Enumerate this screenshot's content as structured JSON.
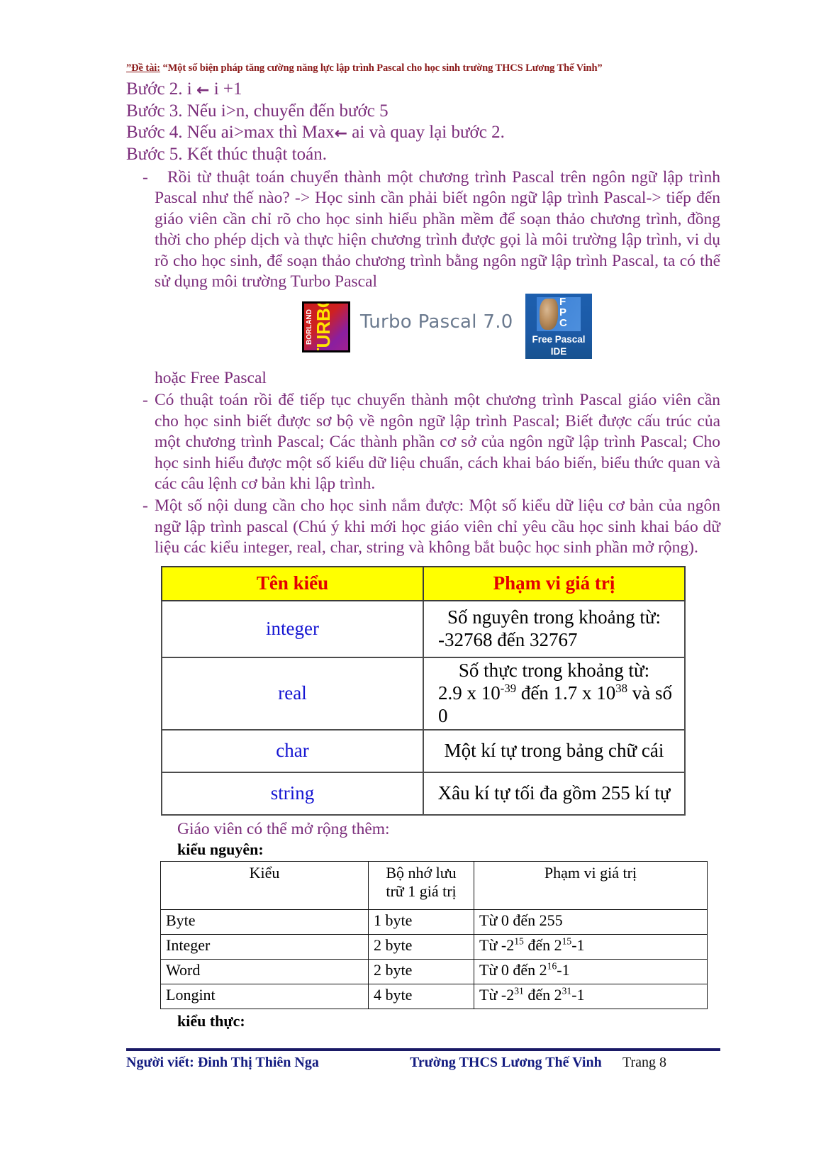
{
  "header": {
    "prefix": "”Đề tài:",
    "title": " “Một số biện pháp tăng cường năng lực lập trình Pascal cho học sinh  trường THCS Lương Thế Vinh”"
  },
  "steps": [
    "Bước 2. i ",
    "Bước 3. Nếu i>n, chuyển đến bước 5",
    "Bước 4. Nếu ai>max thì Max",
    "Bước 5. Kết thúc thuật toán."
  ],
  "step_parts": {
    "step2_pre": "Bước 2. i ",
    "step2_arrow": "←",
    "step2_post": " i +1",
    "step3": "Bước 3. Nếu i>n, chuyển đến bước 5",
    "step4_pre": "Bước 4. Nếu ai>max thì Max",
    "step4_arrow": "←",
    "step4_post": " ai và quay lại bước 2.",
    "step5": "Bước 5. Kết thúc thuật toán."
  },
  "bullets": {
    "dash": "-",
    "p1": "Rồi từ thuật toán chuyển thành một chương trình Pascal trên ngôn ngữ lập trình Pascal như thế nào? -> Học sinh cần phải biết ngôn ngữ lập trình Pascal-> tiếp đến giáo viên cần chỉ rõ cho học sinh hiểu phần mềm để soạn thảo chương trình, đồng thời cho phép dịch và thực hiện chương trình  được gọi là môi trường lập trình, vi dụ rõ cho học sinh, để soạn thảo chương trình bằng ngôn ngữ lập trình Pascal, ta có thể sử dụng môi trường Turbo Pascal",
    "p1_tail": "hoặc Free Pascal",
    "p2": "Có thuật toán rồi để tiếp tục chuyển thành một chương trình Pascal giáo viên cần cho học sinh biết được sơ bộ về ngôn ngữ lập trình Pascal; Biết được cấu trúc của một chương trình Pascal; Các thành phần cơ sở của ngôn ngữ lập trình Pascal; Cho học sinh hiểu được một số kiểu dữ liệu chuẩn, cách khai báo biến, biểu thức quan và các câu lệnh cơ bản khi lập trình.",
    "p3": "Một số nội dung cần cho học sinh nắm được: Một số kiểu dữ liệu cơ bản của ngôn ngữ lập trình pascal (Chú ý khi mới học giáo viên chỉ yêu cầu học sinh khai báo dữ liệu các kiểu integer, real, char, string và không bắt buộc học sinh phần mở rộng)."
  },
  "logos": {
    "borland_top": "BORLAND",
    "borland_main": "TURBO",
    "turbo_label": "Turbo Pascal 7.0",
    "fpc_letters": "F\nP\nC",
    "fpc_caption_1": "Free Pascal",
    "fpc_caption_2": "IDE"
  },
  "table1": {
    "headers": [
      "Tên kiểu",
      "Phạm vi giá trị"
    ],
    "rows": [
      {
        "name": "integer",
        "value_line1": "Số nguyên trong khoảng từ:",
        "value_line2": "-32768  đến 32767"
      },
      {
        "name": "real",
        "value_line1": "Số thực trong khoảng từ:",
        "value_line2_pre": "2.9 x 10",
        "value_line2_sup1": "-39",
        "value_line2_mid": " đến 1.7 x 10",
        "value_line2_sup2": "38",
        "value_line2_post": " và số 0"
      },
      {
        "name": "char",
        "value_line1": "Một kí tự trong bảng chữ cái",
        "value_line2": ""
      },
      {
        "name": "string",
        "value_line1": "Xâu kí tự tối đa gồm 255 kí tự",
        "value_line2": ""
      }
    ]
  },
  "mid_note": "Giáo viên có thể mở rộng thêm:",
  "sub_head_integer": "kiểu nguyên:",
  "sub_head_real": "kiểu thực:",
  "table2": {
    "headers": [
      "Kiểu",
      "Bộ nhớ lưu",
      "Phạm vi giá trị"
    ],
    "header_col2_line2": "trữ 1 giá trị",
    "rows": [
      {
        "kieu": "Byte",
        "bo_nho": "1 byte",
        "pre": "Từ 0 đến 255",
        "sup1": "",
        "mid": "",
        "sup2": "",
        "post": ""
      },
      {
        "kieu": "Integer",
        "bo_nho": "2 byte",
        "pre": "Từ -2",
        "sup1": "15",
        "mid": " đến 2",
        "sup2": "15",
        "post": "-1"
      },
      {
        "kieu": "Word",
        "bo_nho": "2 byte",
        "pre": "Từ 0 đến 2",
        "sup1": "16",
        "mid": "",
        "sup2": "",
        "post": "-1"
      },
      {
        "kieu": "Longint",
        "bo_nho": "4 byte",
        "pre": "Từ -2",
        "sup1": "31",
        "mid": " đến 2",
        "sup2": "31",
        "post": "-1"
      }
    ]
  },
  "footer": {
    "author": "Người viết: Đinh Thị Thiên Nga",
    "school": "Trường THCS Lương Thế Vinh",
    "page": "Trang 8"
  },
  "colors": {
    "header_red": "#8B1A1A",
    "body_purple": "#7B2D7B",
    "table_header_bg": "#FFFF00",
    "table_header_text": "#E30000",
    "type_name_blue": "#1414D2",
    "footer_blue": "#131B80"
  }
}
